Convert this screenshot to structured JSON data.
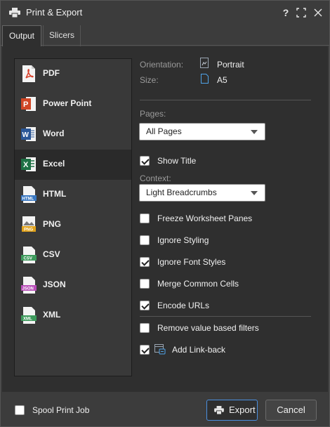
{
  "window": {
    "title": "Print & Export",
    "help_label": "?"
  },
  "tabs": [
    {
      "label": "Output",
      "active": true
    },
    {
      "label": "Slicers",
      "active": false
    }
  ],
  "formats": [
    {
      "label": "PDF",
      "icon": "pdf-file-icon",
      "color": "#d9412b",
      "selected": false
    },
    {
      "label": "Power Point",
      "icon": "powerpoint-file-icon",
      "color": "#d24726",
      "selected": false
    },
    {
      "label": "Word",
      "icon": "word-file-icon",
      "color": "#2b5797",
      "selected": false
    },
    {
      "label": "Excel",
      "icon": "excel-file-icon",
      "color": "#1e7145",
      "selected": true
    },
    {
      "label": "HTML",
      "icon": "html-file-icon",
      "color": "#3a78c2",
      "selected": false
    },
    {
      "label": "PNG",
      "icon": "png-file-icon",
      "color": "#e0a21b",
      "selected": false
    },
    {
      "label": "CSV",
      "icon": "csv-file-icon",
      "color": "#3d9a5c",
      "selected": false
    },
    {
      "label": "JSON",
      "icon": "json-file-icon",
      "color": "#b84db8",
      "selected": false
    },
    {
      "label": "XML",
      "icon": "xml-file-icon",
      "color": "#3d9a5c",
      "selected": false
    }
  ],
  "settings": {
    "orientation_label": "Orientation:",
    "orientation_value": "Portrait",
    "size_label": "Size:",
    "size_value": "A5",
    "pages_label": "Pages:",
    "pages_value": "All Pages",
    "show_title_label": "Show Title",
    "show_title_checked": true,
    "context_label": "Context:",
    "context_value": "Light Breadcrumbs",
    "options": [
      {
        "label": "Freeze Worksheet Panes",
        "checked": false
      },
      {
        "label": "Ignore Styling",
        "checked": false
      },
      {
        "label": "Ignore Font Styles",
        "checked": true
      },
      {
        "label": "Merge Common Cells",
        "checked": false
      },
      {
        "label": "Encode URLs",
        "checked": true
      }
    ],
    "remove_filters_label": "Remove value based filters",
    "remove_filters_checked": false,
    "link_back_label": "Add Link-back",
    "link_back_checked": true
  },
  "footer": {
    "spool_label": "Spool Print Job",
    "spool_checked": false,
    "export_label": "Export",
    "cancel_label": "Cancel"
  },
  "colors": {
    "accent": "#4a8fe0",
    "panel": "#393939",
    "background": "#2f2f2f"
  }
}
